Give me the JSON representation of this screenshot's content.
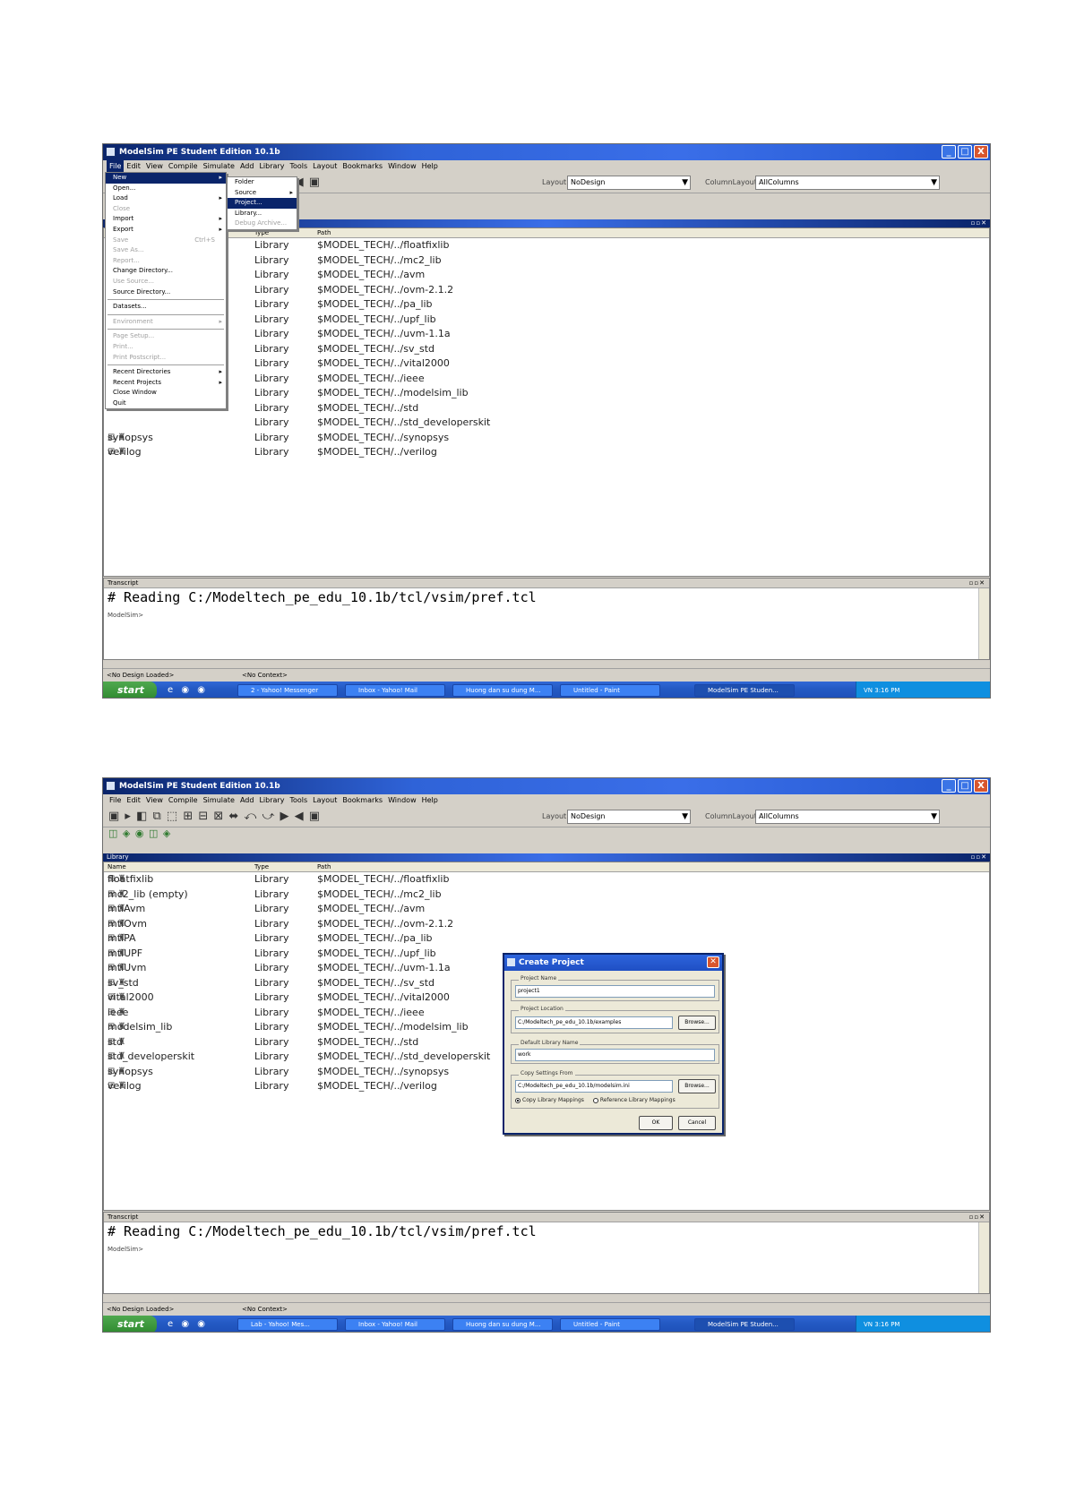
{
  "window": {
    "title": "ModelSim PE Student Edition 10.1b",
    "controls": [
      "_",
      "□",
      "X"
    ]
  },
  "menubar": [
    "File",
    "Edit",
    "View",
    "Compile",
    "Simulate",
    "Add",
    "Library",
    "Tools",
    "Layout",
    "Bookmarks",
    "Window",
    "Help"
  ],
  "toolbar": {
    "glyphs": "▣ ▸ ◧ ⧉ ⬚ ⊞ ⊟ ⊠ ⬌ ⤺ ⤻ ▶ ◀ ▣",
    "glyphs2": "◫ ◈ ◉ ◫ ◈",
    "layout_label": "Layout",
    "layout_value": "NoDesign",
    "column_label": "ColumnLayout",
    "column_value": "AllColumns"
  },
  "file_menu": {
    "items": [
      {
        "label": "New",
        "sub": true,
        "highlighted": true
      },
      {
        "label": "Open..."
      },
      {
        "label": "Load",
        "sub": true
      },
      {
        "label": "Close",
        "disabled": true
      },
      {
        "label": "Import",
        "sub": true
      },
      {
        "label": "Export",
        "sub": true
      },
      {
        "label": "Save",
        "key": "Ctrl+S",
        "disabled": true
      },
      {
        "label": "Save As...",
        "disabled": true
      },
      {
        "label": "Report...",
        "disabled": true
      },
      {
        "label": "Change Directory..."
      },
      {
        "label": "Use Source...",
        "disabled": true
      },
      {
        "label": "Source Directory..."
      },
      {
        "sep": true
      },
      {
        "label": "Datasets..."
      },
      {
        "sep": true
      },
      {
        "label": "Environment",
        "sub": true,
        "disabled": true
      },
      {
        "sep": true
      },
      {
        "label": "Page Setup...",
        "disabled": true
      },
      {
        "label": "Print...",
        "disabled": true
      },
      {
        "label": "Print Postscript...",
        "disabled": true
      },
      {
        "sep": true
      },
      {
        "label": "Recent Directories",
        "sub": true
      },
      {
        "label": "Recent Projects",
        "sub": true
      },
      {
        "label": "Close Window"
      },
      {
        "label": "Quit"
      }
    ]
  },
  "new_submenu": {
    "items": [
      {
        "label": "Folder"
      },
      {
        "label": "Source",
        "sub": true
      },
      {
        "label": "Project...",
        "highlighted": true
      },
      {
        "label": "Library..."
      },
      {
        "label": "Debug Archive...",
        "disabled": true
      }
    ]
  },
  "library_pane": {
    "title": "Library",
    "columns": {
      "name": "Name",
      "type": "Type",
      "path": "Path"
    },
    "rows_top": [
      {
        "name": "floatfixlib",
        "type": "Library",
        "path": "$MODEL_TECH/../floatfixlib"
      },
      {
        "name": "mc2_lib (empty)",
        "type": "Library",
        "path": "$MODEL_TECH/../mc2_lib"
      },
      {
        "name": "mtiAvm",
        "type": "Library",
        "path": "$MODEL_TECH/../avm"
      },
      {
        "name": "mtiOvm",
        "type": "Library",
        "path": "$MODEL_TECH/../ovm-2.1.2"
      },
      {
        "name": "mtiPA",
        "type": "Library",
        "path": "$MODEL_TECH/../pa_lib"
      },
      {
        "name": "mtiUPF",
        "type": "Library",
        "path": "$MODEL_TECH/../upf_lib"
      },
      {
        "name": "mtiUvm",
        "type": "Library",
        "path": "$MODEL_TECH/../uvm-1.1a"
      },
      {
        "name": "sv_std",
        "type": "Library",
        "path": "$MODEL_TECH/../sv_std"
      },
      {
        "name": "vital2000",
        "type": "Library",
        "path": "$MODEL_TECH/../vital2000"
      },
      {
        "name": "ieee",
        "type": "Library",
        "path": "$MODEL_TECH/../ieee"
      },
      {
        "name": "modelsim_lib",
        "type": "Library",
        "path": "$MODEL_TECH/../modelsim_lib"
      },
      {
        "name": "std",
        "type": "Library",
        "path": "$MODEL_TECH/../std"
      },
      {
        "name": "std_developerskit",
        "type": "Library",
        "path": "$MODEL_TECH/../std_developerskit"
      },
      {
        "name": "synopsys",
        "type": "Library",
        "path": "$MODEL_TECH/../synopsys"
      },
      {
        "name": "verilog",
        "type": "Library",
        "path": "$MODEL_TECH/../verilog"
      }
    ],
    "rows": [
      {
        "name": "floatfixlib",
        "type": "Library",
        "path": "$MODEL_TECH/../floatfixlib"
      },
      {
        "name": "mc2_lib (empty)",
        "type": "Library",
        "path": "$MODEL_TECH/../mc2_lib"
      },
      {
        "name": "mtiAvm",
        "type": "Library",
        "path": "$MODEL_TECH/../avm"
      },
      {
        "name": "mtiOvm",
        "type": "Library",
        "path": "$MODEL_TECH/../ovm-2.1.2"
      },
      {
        "name": "mtiPA",
        "type": "Library",
        "path": "$MODEL_TECH/../pa_lib"
      },
      {
        "name": "mtiUPF",
        "type": "Library",
        "path": "$MODEL_TECH/../upf_lib"
      },
      {
        "name": "mtiUvm",
        "type": "Library",
        "path": "$MODEL_TECH/../uvm-1.1a"
      },
      {
        "name": "sv_std",
        "type": "Library",
        "path": "$MODEL_TECH/../sv_std"
      },
      {
        "name": "vital2000",
        "type": "Library",
        "path": "$MODEL_TECH/../vital2000"
      },
      {
        "name": "ieee",
        "type": "Library",
        "path": "$MODEL_TECH/../ieee"
      },
      {
        "name": "modelsim_lib",
        "type": "Library",
        "path": "$MODEL_TECH/../modelsim_lib"
      },
      {
        "name": "std",
        "type": "Library",
        "path": "$MODEL_TECH/../std"
      },
      {
        "name": "std_developerskit",
        "type": "Library",
        "path": "$MODEL_TECH/../std_developerskit"
      },
      {
        "name": "synopsys",
        "type": "Library",
        "path": "$MODEL_TECH/../synopsys"
      },
      {
        "name": "verilog",
        "type": "Library",
        "path": "$MODEL_TECH/../verilog"
      }
    ]
  },
  "transcript": {
    "title": "Transcript",
    "line": "# Reading C:/Modeltech_pe_edu_10.1b/tcl/vsim/pref.tcl",
    "prompt": "ModelSim>"
  },
  "statusbar": {
    "left": "<No Design Loaded>",
    "right": "<No Context>"
  },
  "taskbar": {
    "start": "start",
    "quicklaunch": "e ◉ ◉",
    "shot1_tasks": [
      "2 - Yahoo! Messenger",
      "Inbox - Yahoo! Mail",
      "Huong dan su dung M...",
      "Untitled - Paint",
      "ModelSim PE Studen..."
    ],
    "shot2_tasks": [
      "Lab - Yahoo! Mes...",
      "Inbox - Yahoo! Mail",
      "Huong dan su dung M...",
      "Untitled - Paint",
      "ModelSim PE Studen..."
    ],
    "tray": "VN 3:16 PM"
  },
  "dialog": {
    "title": "Create Project",
    "project_name_label": "Project Name",
    "project_name": "project1",
    "project_location_label": "Project Location",
    "project_location": "C:/Modeltech_pe_edu_10.1b/examples",
    "browse1": "Browse...",
    "default_lib_label": "Default Library Name",
    "default_lib": "work",
    "copy_settings_label": "Copy Settings From",
    "copy_settings": "C:/Modeltech_pe_edu_10.1b/modelsim.ini",
    "browse2": "Browse...",
    "radio_copy": "Copy Library Mappings",
    "radio_ref": "Reference Library Mappings",
    "ok": "OK",
    "cancel": "Cancel"
  }
}
